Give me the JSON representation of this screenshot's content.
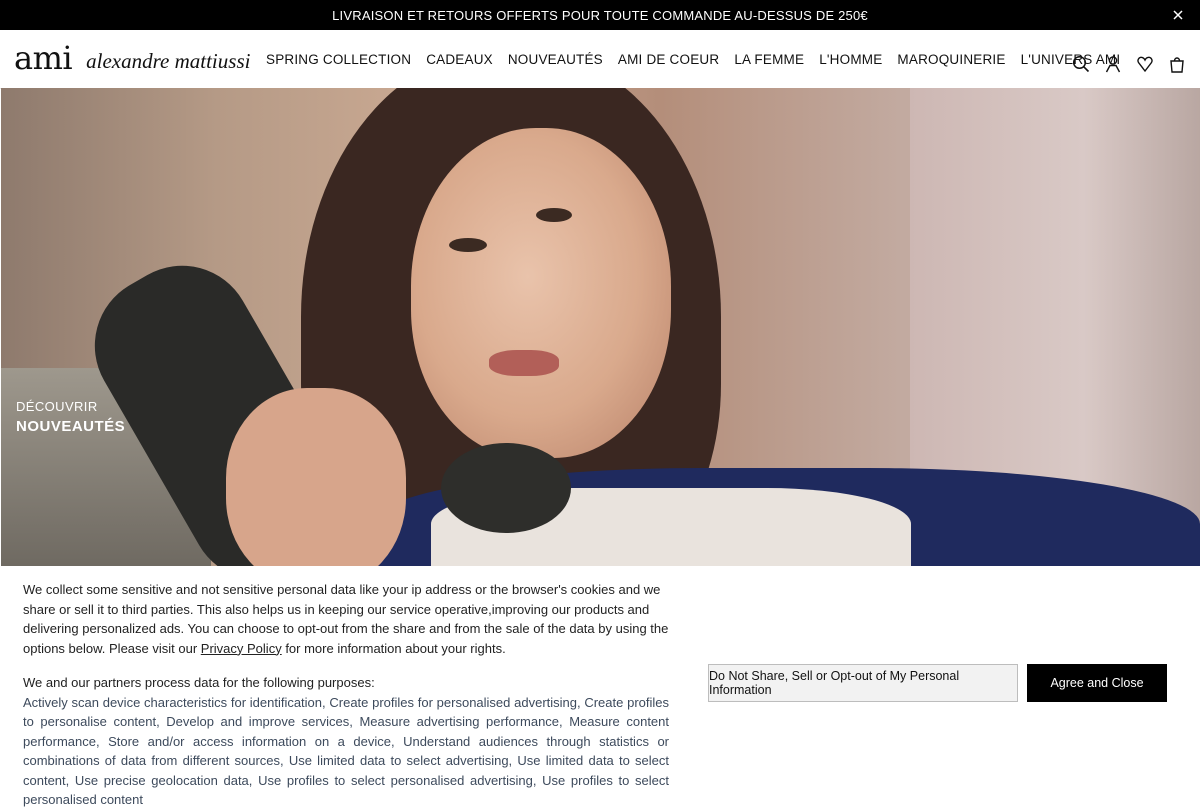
{
  "promo": {
    "text": "LIVRAISON ET RETOURS OFFERTS POUR TOUTE COMMANDE AU-DESSUS DE 250€"
  },
  "brand": {
    "logo_text": "ami",
    "signature": "alexandre mattiussi"
  },
  "nav": [
    {
      "label": "SPRING COLLECTION"
    },
    {
      "label": "CADEAUX"
    },
    {
      "label": "NOUVEAUTÉS"
    },
    {
      "label": "AMI DE COEUR"
    },
    {
      "label": "LA FEMME"
    },
    {
      "label": "L'HOMME"
    },
    {
      "label": "MAROQUINERIE"
    },
    {
      "label": "L'UNIVERS AMI"
    }
  ],
  "header_icons": [
    "search-icon",
    "account-icon",
    "wishlist-icon",
    "cart-icon"
  ],
  "hero": {
    "eyebrow": "DÉCOUVRIR",
    "title": "NOUVEAUTÉS"
  },
  "consent": {
    "intro_before_link": "We collect some sensitive and not sensitive personal data like your ip address or the browser's cookies and we share or sell it to third parties. This also helps us in keeping our service operative,improving our products and delivering personalized ads. You can choose to opt-out from the share and from the sale of the data by using the options below. Please visit our ",
    "link_text": "Privacy Policy",
    "intro_after_link": " for more information about your rights.",
    "purposes_heading": "We and our partners process data for the following purposes:",
    "purposes_text": "Actively scan device characteristics for identification, Create profiles for personalised advertising, Create profiles to personalise content, Develop and improve services, Measure advertising performance, Measure content performance, Store and/or access information on a device, Understand audiences through statistics or combinations of data from different sources, Use limited data to select advertising, Use limited data to select content, Use precise geolocation data, Use profiles to select personalised advertising, Use profiles to select personalised content",
    "optout_label": "Do Not Share, Sell or Opt-out of My Personal Information",
    "agree_label": "Agree and Close"
  }
}
